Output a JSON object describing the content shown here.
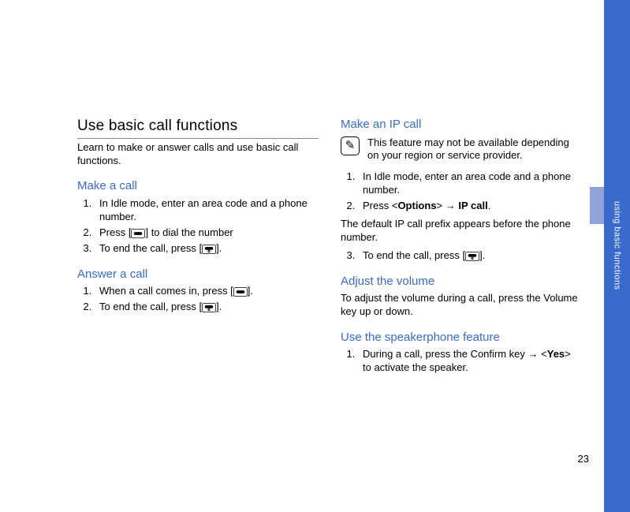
{
  "page_number": "23",
  "side_label": "using basic functions",
  "left": {
    "heading": "Use basic call functions",
    "intro": "Learn to make or answer calls and use basic call functions.",
    "make_call_heading": "Make a call",
    "make_call_steps": {
      "s1": "In Idle mode, enter an area code and a phone number.",
      "s2a": "Press [",
      "s2b": "] to dial the number",
      "s3a": "To end the call, press [",
      "s3b": "]."
    },
    "answer_heading": "Answer a call",
    "answer_steps": {
      "s1a": "When a call comes in, press [",
      "s1b": "].",
      "s2a": "To end the call, press [",
      "s2b": "]."
    }
  },
  "right": {
    "ip_heading": "Make an IP call",
    "note": "This feature may not be available depending on your region or service provider.",
    "ip_steps": {
      "s1": "In Idle mode, enter an area code and a phone number.",
      "s2a": "Press <",
      "s2b": "Options",
      "s2c": "> → ",
      "s2d": "IP call",
      "s2e": ".",
      "s2_sub": "The default IP call prefix appears before the phone number.",
      "s3a": "To end the call, press [",
      "s3b": "]."
    },
    "vol_heading": "Adjust the volume",
    "vol_text": "To adjust the volume during a call, press the Volume key up or down.",
    "spk_heading": "Use the speakerphone feature",
    "spk_steps": {
      "s1a": "During a call, press the Confirm key → <",
      "s1b": "Yes",
      "s1c": "> to activate the speaker."
    }
  }
}
